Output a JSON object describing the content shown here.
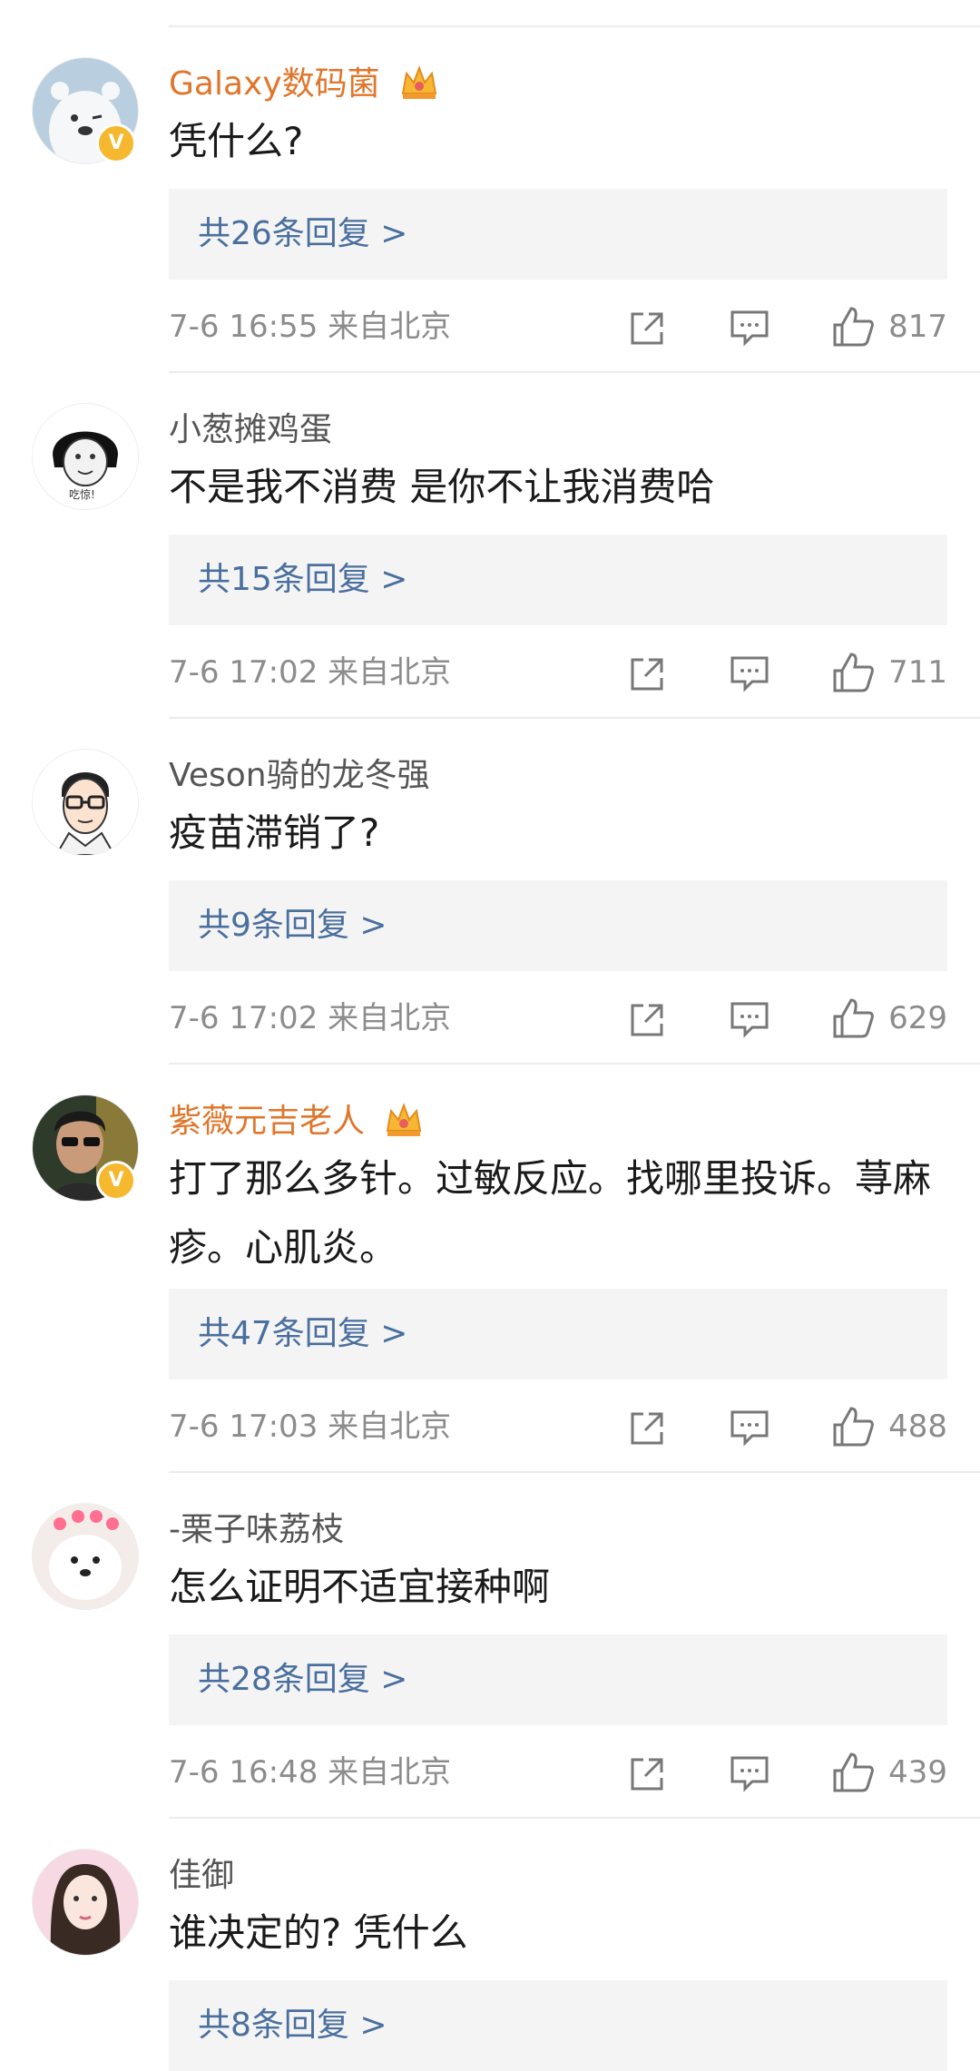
{
  "comments": [
    {
      "username": "Galaxy数码菌",
      "vip": true,
      "verified": true,
      "content": "凭什么?",
      "replies": "共26条回复 >",
      "time": "7-6 16:55 来自北京",
      "likes": "817",
      "avatar_icon": "polar-bear-avatar"
    },
    {
      "username": "小葱摊鸡蛋",
      "vip": false,
      "verified": false,
      "content": "不是我不消费 是你不让我消费哈",
      "replies": "共15条回复 >",
      "time": "7-6 17:02 来自北京",
      "likes": "711",
      "avatar_icon": "meme-face-avatar"
    },
    {
      "username": "Veson骑的龙冬强",
      "vip": false,
      "verified": false,
      "content": "疫苗滞销了?",
      "replies": "共9条回复 >",
      "time": "7-6 17:02 来自北京",
      "likes": "629",
      "avatar_icon": "cartoon-man-glasses-avatar"
    },
    {
      "username": "紫薇元吉老人",
      "vip": true,
      "verified": true,
      "content": "打了那么多针。过敏反应。找哪里投诉。荨麻疹。心肌炎。",
      "replies": "共47条回复 >",
      "time": "7-6 17:03 来自北京",
      "likes": "488",
      "avatar_icon": "man-sunglasses-avatar"
    },
    {
      "username": "-栗子味荔枝",
      "vip": false,
      "verified": false,
      "content": "怎么证明不适宜接种啊",
      "replies": "共28条回复 >",
      "time": "7-6 16:48 来自北京",
      "likes": "439",
      "avatar_icon": "white-dog-avatar"
    },
    {
      "username": "佳御",
      "vip": false,
      "verified": false,
      "content": "谁决定的? 凭什么",
      "replies": "共8条回复 >",
      "time": "",
      "likes": "",
      "avatar_icon": "woman-portrait-avatar"
    }
  ],
  "colors": {
    "vip_name": "#e0762b",
    "reply_link": "#4a6f9e",
    "meta_text": "#8c8c8c",
    "reply_bg": "#f4f4f4"
  }
}
